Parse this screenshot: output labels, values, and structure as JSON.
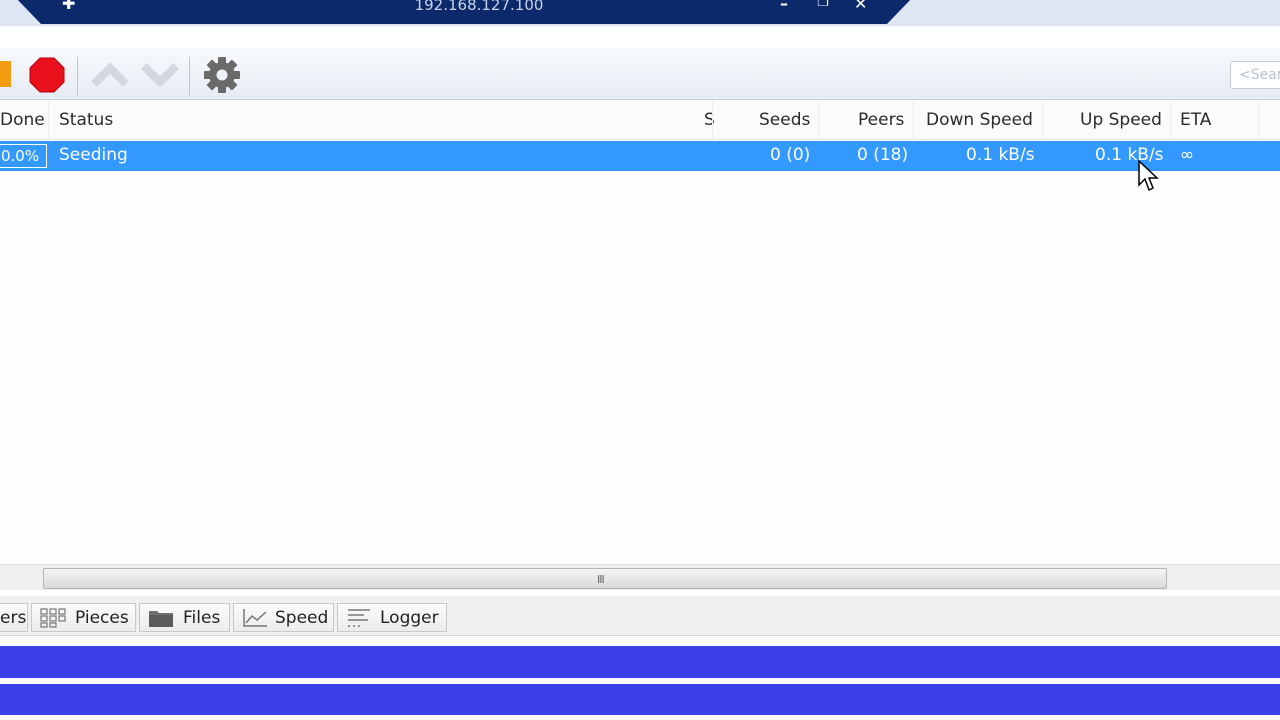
{
  "remote_bar": {
    "title": "192.168.127.100"
  },
  "toolbar": {
    "search_placeholder": "<Search>"
  },
  "columns": [
    "Done",
    "Status",
    "S",
    "Seeds",
    "Peers",
    "Down Speed",
    "Up Speed",
    "ETA"
  ],
  "torrents": [
    {
      "done": "0.0%",
      "status": "Seeding",
      "seeds": "0 (0)",
      "peers": "0 (18)",
      "down_speed": "0.1 kB/s",
      "up_speed": "0.1 kB/s",
      "eta": "∞"
    }
  ],
  "tabs": [
    {
      "label": "ers"
    },
    {
      "label": "Pieces",
      "icon": "pieces-icon"
    },
    {
      "label": "Files",
      "icon": "folder-icon"
    },
    {
      "label": "Speed",
      "icon": "speed-graph-icon"
    },
    {
      "label": "Logger",
      "icon": "logger-icon"
    }
  ],
  "colors": {
    "selection": "#3399ff",
    "stripe": "#3b3fe8",
    "rdp_bar": "#0c2a6b",
    "stop": "#e8101a",
    "pause": "#f39c12"
  }
}
